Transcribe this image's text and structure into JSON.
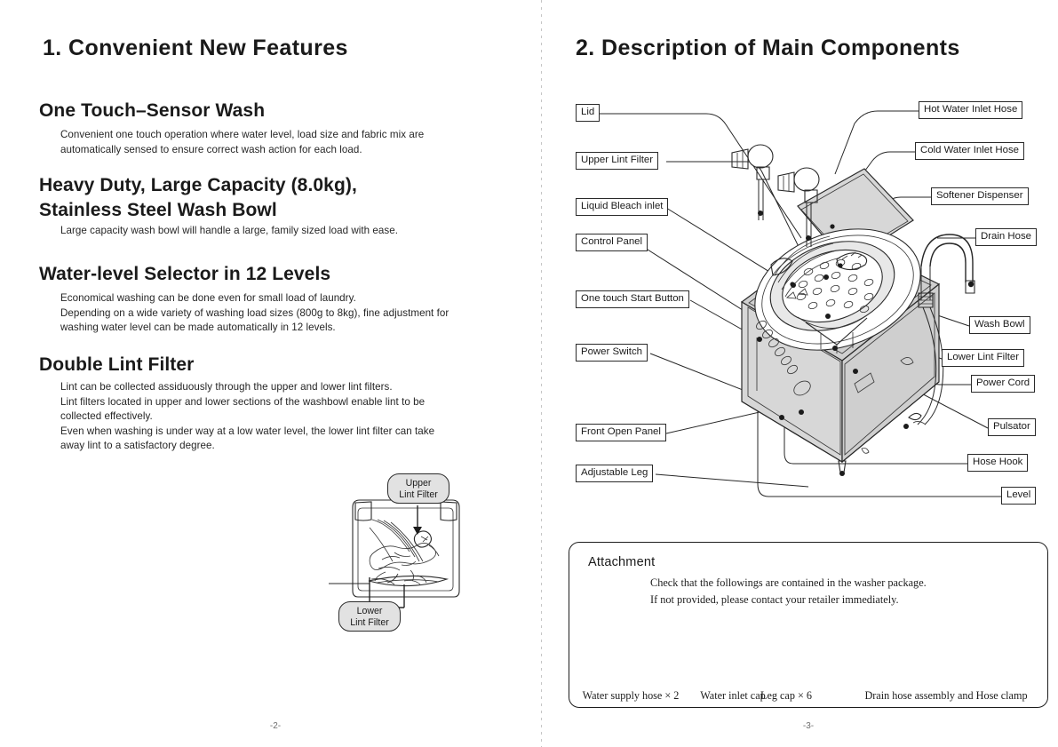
{
  "document": {
    "left_page": {
      "chapter_title": "1. Convenient New Features",
      "folio": "-2-",
      "sections": [
        {
          "heading": "One Touch–Sensor Wash",
          "lines": [
            "Convenient one touch operation where water level, load size and fabric mix are",
            "automatically sensed to ensure correct wash action for each load."
          ]
        },
        {
          "heading_line1": "Heavy Duty, Large Capacity (8.0kg),",
          "heading_line2": "Stainless Steel Wash Bowl",
          "lines": [
            "Large capacity wash bowl will handle a large, family sized load with ease."
          ]
        },
        {
          "heading": "Water-level Selector in 12 Levels",
          "lines": [
            "Economical washing can be done even for small load of laundry.",
            "Depending on a wide variety of washing load sizes (800g to 8kg), fine adjustment for",
            "washing water level can be made automatically in 12 levels."
          ]
        },
        {
          "heading": "Double Lint Filter",
          "lines": [
            "Lint can be collected assiduously through the upper and lower lint filters.",
            "Lint filters located in upper and lower sections of the washbowl enable lint to be",
            "collected effectively.",
            "Even when washing is under way at a low water level, the lower lint filter can take",
            "away lint to a satisfactory degree."
          ]
        }
      ],
      "lint_diagram": {
        "upper_bubble_line1": "Upper",
        "upper_bubble_line2": "Lint Filter",
        "lower_bubble_line1": "Lower",
        "lower_bubble_line2": "Lint Filter"
      }
    },
    "right_page": {
      "chapter_title": "2. Description of Main Components",
      "folio": "-3-",
      "callouts_left": [
        {
          "label": "Lid"
        },
        {
          "label": "Upper Lint Filter"
        },
        {
          "label": "Liquid Bleach inlet"
        },
        {
          "label": "Control Panel"
        },
        {
          "label": "One touch Start Button"
        },
        {
          "label": "Power Switch"
        },
        {
          "label": "Front Open Panel"
        },
        {
          "label": "Adjustable Leg"
        }
      ],
      "callouts_right": [
        {
          "label": "Hot Water Inlet Hose"
        },
        {
          "label": "Cold Water Inlet Hose"
        },
        {
          "label": "Softener Dispenser"
        },
        {
          "label": "Drain Hose"
        },
        {
          "label": "Wash Bowl"
        },
        {
          "label": "Lower Lint Filter"
        },
        {
          "label": "Power Cord"
        },
        {
          "label": "Pulsator"
        },
        {
          "label": "Hose Hook"
        },
        {
          "label": "Level"
        }
      ],
      "attachment": {
        "title": "Attachment",
        "intro_line1": "Check that the followings are contained in the washer package.",
        "intro_line2": "If not provided, please contact your retailer immediately.",
        "items": [
          {
            "caption": "Water supply hose × 2"
          },
          {
            "caption": "Water inlet cap"
          },
          {
            "caption": "Leg cap × 6"
          },
          {
            "caption": "Drain hose assembly and Hose clamp"
          }
        ]
      }
    }
  }
}
